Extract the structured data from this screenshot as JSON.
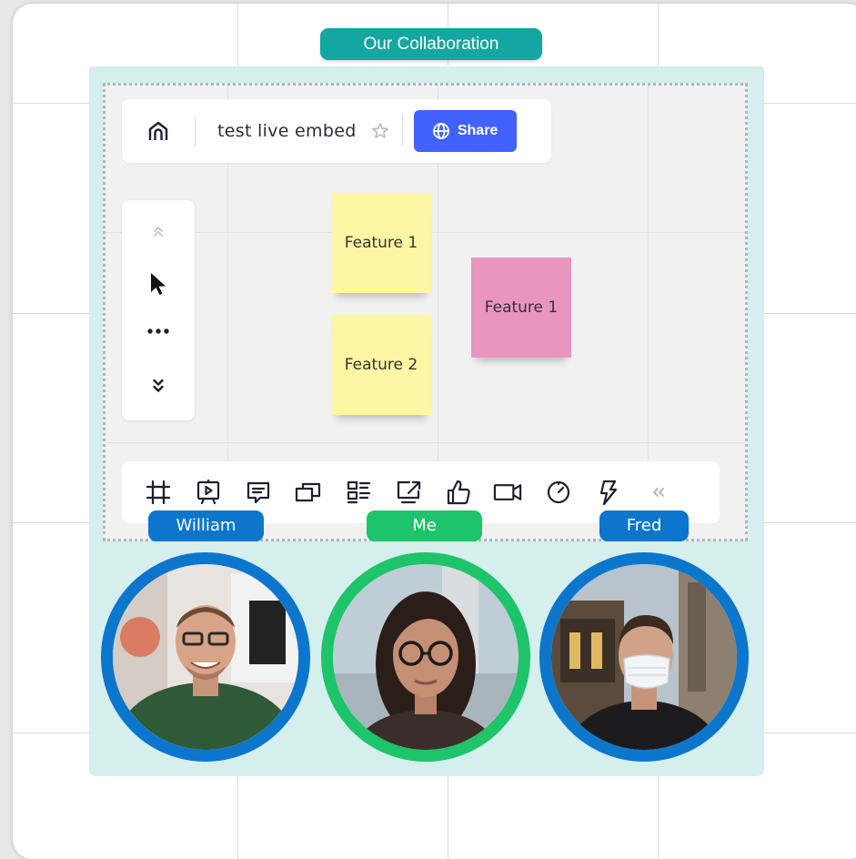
{
  "frame": {
    "title": "Our Collaboration",
    "accent_color": "#14a6a0"
  },
  "embed": {
    "board_title": "test live embed",
    "share_label": "Share",
    "share_color": "#4262ff",
    "icons": {
      "home": "home-icon",
      "star": "star-icon",
      "share": "globe-icon"
    },
    "left_toolbar": [
      "chevrons-up-icon",
      "cursor-icon",
      "more-icon",
      "chevrons-down-icon"
    ],
    "bottom_toolbar": [
      "frame-icon",
      "presentation-icon",
      "comment-icon",
      "cards-icon",
      "kanban-icon",
      "share-screen-icon",
      "thumbs-up-icon",
      "video-icon",
      "timer-icon",
      "lightning-icon",
      "collapse-icon"
    ],
    "stickies": [
      {
        "text": "Feature 1",
        "color": "#fdf6a3"
      },
      {
        "text": "Feature 2",
        "color": "#fdf6a3"
      },
      {
        "text": "Feature 1",
        "color": "#ea94c0"
      }
    ]
  },
  "participants": [
    {
      "name": "William",
      "color": "#0b76cc"
    },
    {
      "name": "Me",
      "color": "#1dc469"
    },
    {
      "name": "Fred",
      "color": "#0b76cc"
    }
  ]
}
